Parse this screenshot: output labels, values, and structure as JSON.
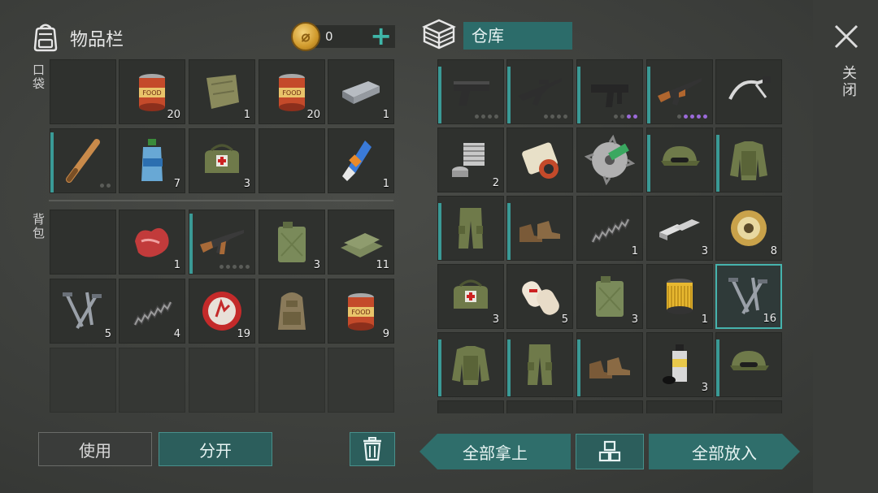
{
  "inventory": {
    "title": "物品栏",
    "icon": "backpack-icon",
    "coins": "0",
    "pocket_label": "口袋",
    "backpack_label": "背包",
    "pocket": [
      {
        "icon": "empty",
        "count": ""
      },
      {
        "icon": "canned-food-icon",
        "count": "20"
      },
      {
        "icon": "cloth-rag-icon",
        "count": "1"
      },
      {
        "icon": "canned-food-icon",
        "count": "20"
      },
      {
        "icon": "metal-ingot-icon",
        "count": "1"
      },
      {
        "icon": "baseball-bat-icon",
        "count": "",
        "dots": 2,
        "purple": 0,
        "bar": 0.95
      },
      {
        "icon": "water-bottle-icon",
        "count": "7"
      },
      {
        "icon": "medkit-bag-icon",
        "count": "3"
      },
      {
        "icon": "empty",
        "count": ""
      },
      {
        "icon": "glue-tube-icon",
        "count": "1"
      }
    ],
    "backpack": [
      {
        "icon": "empty",
        "count": ""
      },
      {
        "icon": "raw-meat-icon",
        "count": "1"
      },
      {
        "icon": "assault-rifle-icon",
        "count": "",
        "dots": 5,
        "purple": 0,
        "bar": 0.95
      },
      {
        "icon": "jerrycan-icon",
        "count": "3"
      },
      {
        "icon": "cloth-stack-icon",
        "count": "11"
      },
      {
        "icon": "nails-icon",
        "count": "5"
      },
      {
        "icon": "spring-icon",
        "count": "4"
      },
      {
        "icon": "bottle-cap-icon",
        "count": "19"
      },
      {
        "icon": "backpack-item-icon",
        "count": ""
      },
      {
        "icon": "canned-food-icon",
        "count": "9"
      }
    ],
    "empty_row": 5
  },
  "warehouse": {
    "title": "仓库",
    "icon": "crate-icon",
    "items": [
      {
        "icon": "pistol-icon",
        "count": "",
        "dots": 4,
        "purple": 0,
        "bar": 0.9
      },
      {
        "icon": "assault-rifle-m4-icon",
        "count": "",
        "dots": 4,
        "purple": 0,
        "bar": 0.9
      },
      {
        "icon": "uzi-icon",
        "count": "",
        "dots": 4,
        "purple": 2,
        "bar": 0.9
      },
      {
        "icon": "ak-rifle-icon",
        "count": "",
        "dots": 5,
        "purple": 4,
        "bar": 0.9
      },
      {
        "icon": "handlebar-icon",
        "count": ""
      },
      {
        "icon": "engine-part-icon",
        "count": "2"
      },
      {
        "icon": "magazine-roll-icon",
        "count": ""
      },
      {
        "icon": "saw-blade-icon",
        "count": ""
      },
      {
        "icon": "military-cap-icon",
        "count": "",
        "bar": 0.9
      },
      {
        "icon": "military-jacket-icon",
        "count": "",
        "bar": 0.9
      },
      {
        "icon": "military-pants-icon",
        "count": "",
        "bar": 0.9
      },
      {
        "icon": "military-boots-icon",
        "count": "",
        "bar": 0.9
      },
      {
        "icon": "spring-icon",
        "count": "1"
      },
      {
        "icon": "metal-bars-icon",
        "count": "3"
      },
      {
        "icon": "wire-spool-icon",
        "count": "8"
      },
      {
        "icon": "medkit-bag-icon",
        "count": "3"
      },
      {
        "icon": "bandage-icon",
        "count": "5"
      },
      {
        "icon": "jerrycan-icon",
        "count": "3"
      },
      {
        "icon": "filter-icon",
        "count": "1"
      },
      {
        "icon": "nails-icon",
        "count": "16",
        "selected": true
      },
      {
        "icon": "military-jacket-icon",
        "count": "",
        "bar": 0.9
      },
      {
        "icon": "military-pants-icon",
        "count": "",
        "bar": 0.9
      },
      {
        "icon": "military-boots-icon",
        "count": "",
        "bar": 0.9
      },
      {
        "icon": "spray-can-icon",
        "count": "3"
      },
      {
        "icon": "military-cap-icon",
        "count": "",
        "bar": 0.9
      }
    ]
  },
  "buttons": {
    "use": "使用",
    "split": "分开",
    "take_all": "全部拿上",
    "put_all": "全部放入"
  },
  "close_label": "关闭",
  "colors": {
    "accent": "#2f6e6b",
    "bar": "#3a9a96",
    "purple_dot": "#9b6ad9"
  }
}
